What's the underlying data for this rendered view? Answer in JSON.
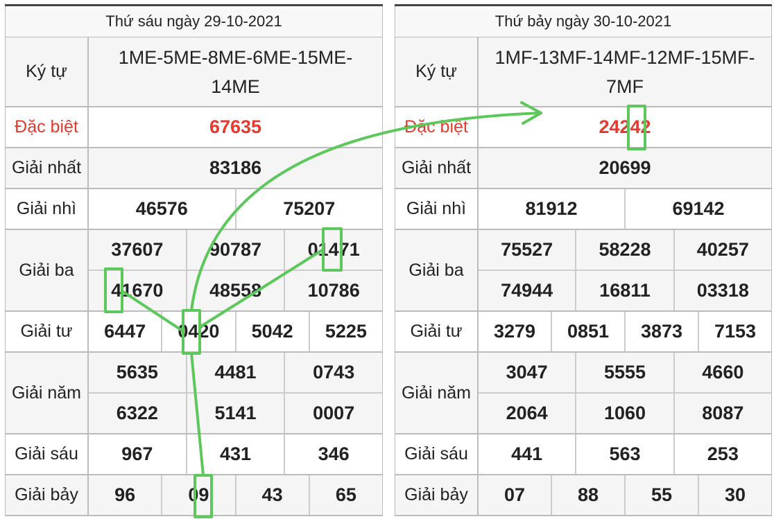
{
  "left": {
    "header": "Thứ sáu ngày 29-10-2021",
    "labels": {
      "ky_tu": "Ký tự",
      "dac_biet": "Đặc biệt",
      "nhat": "Giải nhất",
      "nhi": "Giải nhì",
      "ba": "Giải ba",
      "tu": "Giải tư",
      "nam": "Giải năm",
      "sau": "Giải sáu",
      "bay": "Giải bảy"
    },
    "ky_tu": "1ME-5ME-8ME-6ME-15ME-14ME",
    "dac_biet": "67635",
    "nhat": "83186",
    "nhi": [
      "46576",
      "75207"
    ],
    "ba": [
      "37607",
      "90787",
      "01471",
      "41670",
      "48558",
      "10786"
    ],
    "tu": [
      "6447",
      "0420",
      "5042",
      "5225"
    ],
    "nam": [
      "5635",
      "4481",
      "0743",
      "6322",
      "5141",
      "0007"
    ],
    "sau": [
      "967",
      "431",
      "346"
    ],
    "bay": [
      "96",
      "09",
      "43",
      "65"
    ]
  },
  "right": {
    "header": "Thứ bảy ngày 30-10-2021",
    "labels": {
      "ky_tu": "Ký tự",
      "dac_biet": "Đặc biệt",
      "nhat": "Giải nhất",
      "nhi": "Giải nhì",
      "ba": "Giải ba",
      "tu": "Giải tư",
      "nam": "Giải năm",
      "sau": "Giải sáu",
      "bay": "Giải bảy"
    },
    "ky_tu": "1MF-13MF-14MF-12MF-15MF-7MF",
    "dac_biet": "24242",
    "nhat": "20699",
    "nhi": [
      "81912",
      "69142"
    ],
    "ba": [
      "75527",
      "58228",
      "40257",
      "74944",
      "16811",
      "03318"
    ],
    "tu": [
      "3279",
      "0851",
      "3873",
      "7153"
    ],
    "nam": [
      "3047",
      "5555",
      "4660",
      "2064",
      "1060",
      "8087"
    ],
    "sau": [
      "441",
      "563",
      "253"
    ],
    "bay": [
      "07",
      "88",
      "55",
      "30"
    ]
  },
  "colors": {
    "special": "#e53a2f",
    "annotation": "#5cc85c"
  }
}
